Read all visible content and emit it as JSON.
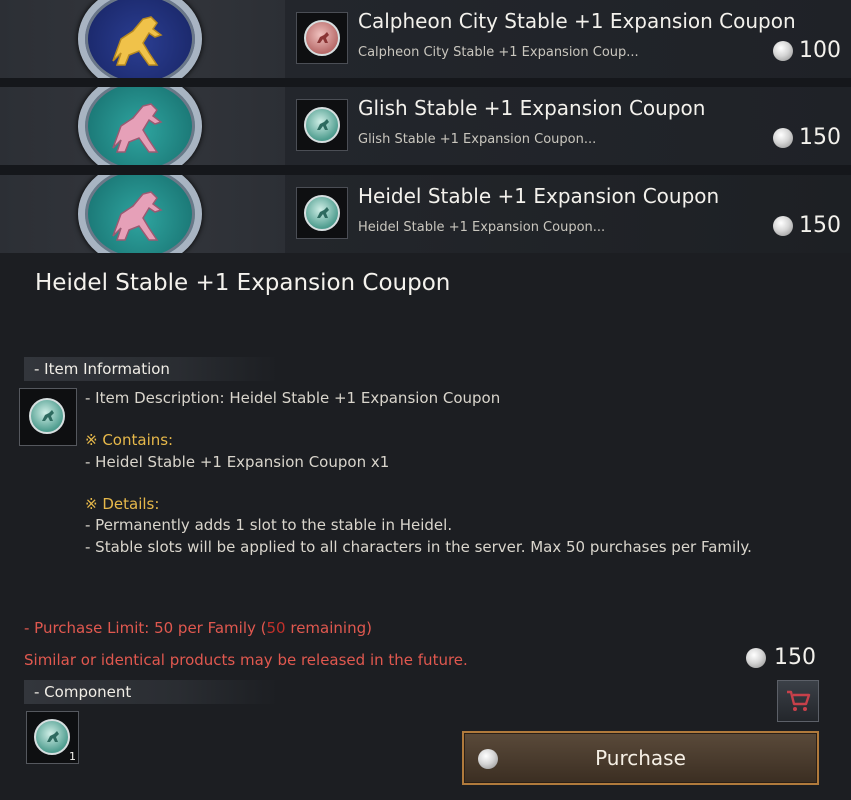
{
  "list": {
    "items": [
      {
        "title": "Calpheon City Stable +1 Expansion Coupon",
        "subtitle": "Calpheon City Stable +1 Expansion Coup...",
        "price": "100"
      },
      {
        "title": "Glish Stable +1 Expansion Coupon",
        "subtitle": "Glish Stable +1 Expansion Coupon...",
        "price": "150"
      },
      {
        "title": "Heidel Stable +1 Expansion Coupon",
        "subtitle": "Heidel Stable +1 Expansion Coupon...",
        "price": "150"
      }
    ]
  },
  "detail": {
    "title": "Heidel Stable +1 Expansion Coupon",
    "item_info_header": "- Item Information",
    "description": "- Item Description: Heidel Stable +1 Expansion Coupon",
    "contains_label": "※ Contains:",
    "contains_item": "- Heidel Stable +1 Expansion Coupon x1",
    "details_label": "※ Details:",
    "detail_line1": "- Permanently adds 1 slot to the stable in Heidel.",
    "detail_line2": "- Stable slots will be applied to all characters in the server. Max 50 purchases per Family.",
    "limit_prefix": "- Purchase Limit: 50 per Family (",
    "limit_remaining": "50",
    "limit_suffix": " remaining)",
    "notice": "Similar or identical products may be released in the future.",
    "price": "150",
    "component_header": "- Component",
    "component_qty": "1",
    "purchase_label": "Purchase"
  },
  "colors": {
    "accent_gold": "#e6b84a",
    "warning_red": "#e0584f",
    "purchase_border": "#b07a3c"
  },
  "icons": [
    "horse-medal-icon",
    "stable-coupon-icon",
    "pearl-currency-icon",
    "cart-icon"
  ]
}
